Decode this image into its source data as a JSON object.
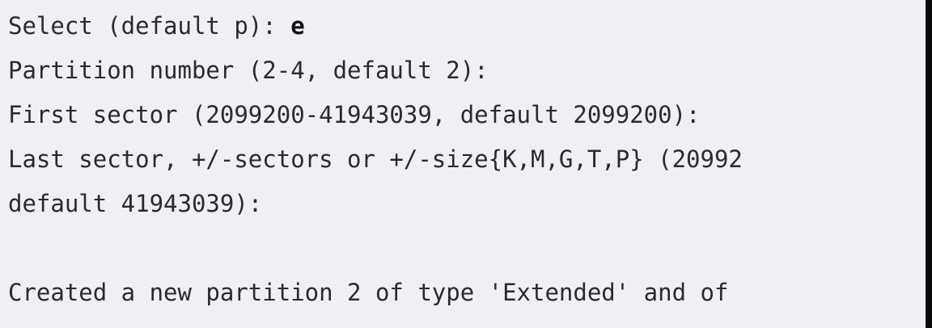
{
  "terminal": {
    "lines": [
      {
        "prompt": "Select (default p): ",
        "input": "e"
      },
      {
        "text": "Partition number (2-4, default 2):"
      },
      {
        "text": "First sector (2099200-41943039, default 2099200):"
      },
      {
        "text": "Last sector, +/-sectors or +/-size{K,M,G,T,P} (20992"
      },
      {
        "text": "default 41943039):"
      },
      {
        "text": ""
      },
      {
        "text": "Created a new partition 2 of type 'Extended' and of"
      }
    ]
  }
}
